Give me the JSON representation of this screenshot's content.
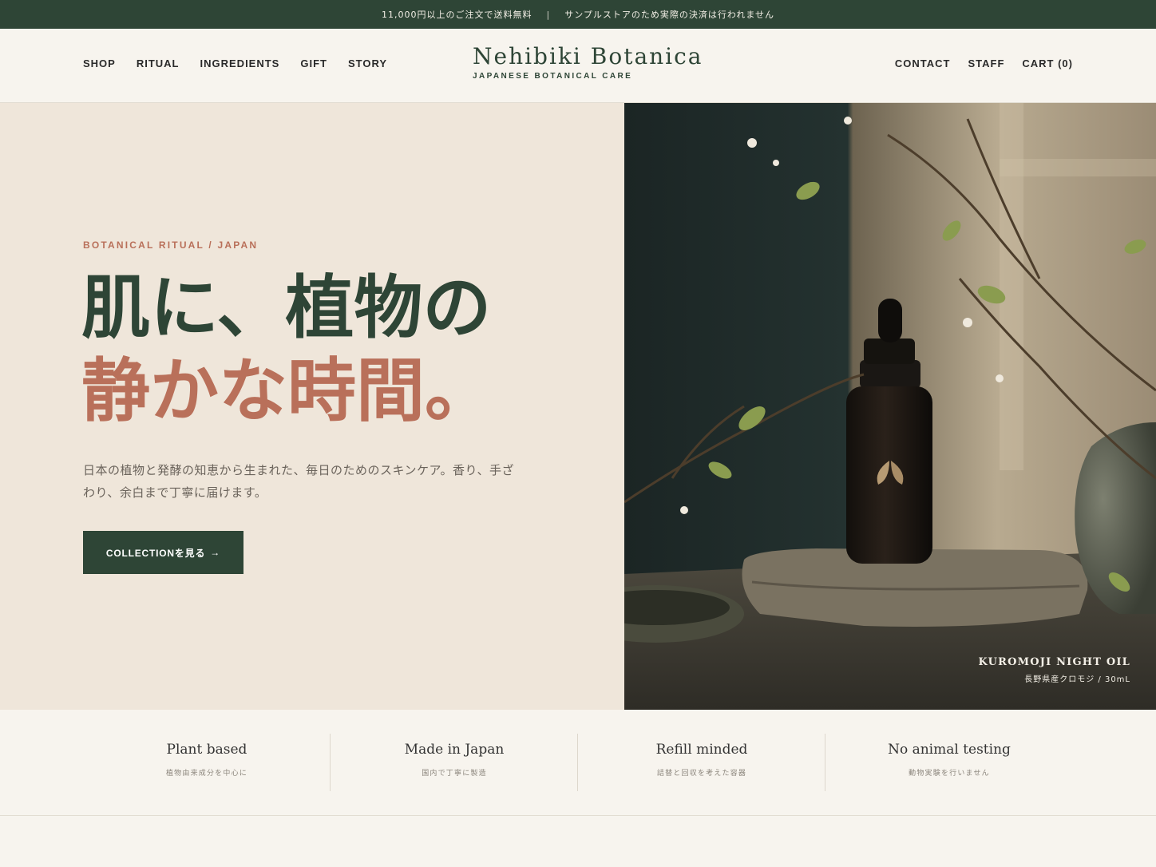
{
  "announcement": {
    "shipping": "11,000円以上のご注文で送料無料",
    "separator": "|",
    "notice": "サンプルストアのため実際の決済は行われません"
  },
  "header": {
    "nav_left": [
      "SHOP",
      "RITUAL",
      "INGREDIENTS",
      "GIFT",
      "STORY"
    ],
    "brand_name": "Nehibiki Botanica",
    "brand_tagline": "JAPANESE BOTANICAL CARE",
    "nav_right": [
      "CONTACT",
      "STAFF",
      "CART (0)"
    ]
  },
  "hero": {
    "eyebrow": "BOTANICAL RITUAL / JAPAN",
    "headline_line1": "肌に、植物の",
    "headline_line2": "静かな時間。",
    "description": "日本の植物と発酵の知恵から生まれた、毎日のためのスキンケア。香り、手ざわり、余白まで丁寧に届けます。",
    "cta_label": "COLLECTIONを見る",
    "cta_arrow": "→",
    "product_name": "KUROMOJI NIGHT OIL",
    "product_meta": "長野県産クロモジ / 30mL"
  },
  "features": [
    {
      "title": "Plant based",
      "subtitle": "植物由来成分を中心に"
    },
    {
      "title": "Made in Japan",
      "subtitle": "国内で丁寧に製造"
    },
    {
      "title": "Refill minded",
      "subtitle": "詰替と回収を考えた容器"
    },
    {
      "title": "No animal testing",
      "subtitle": "動物実験を行いません"
    }
  ],
  "colors": {
    "brand_green": "#2e4536",
    "accent_terracotta": "#b9705a",
    "hero_bg": "#efe6da",
    "page_bg": "#f7f4ee"
  }
}
